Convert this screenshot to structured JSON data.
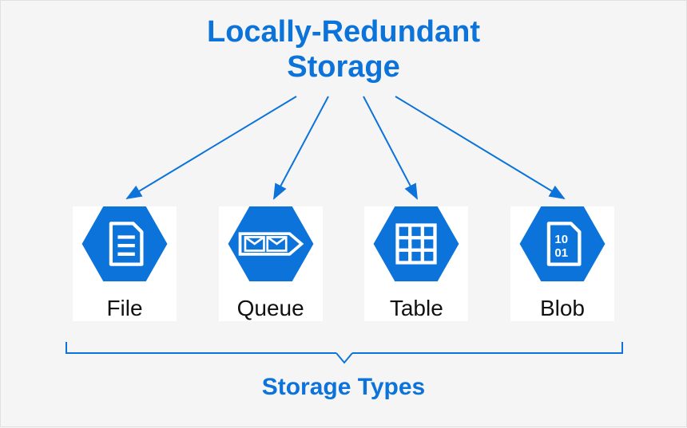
{
  "title_line1": "Locally-Redundant",
  "title_line2": "Storage",
  "items": [
    {
      "name": "file",
      "label": "File"
    },
    {
      "name": "queue",
      "label": "Queue"
    },
    {
      "name": "table",
      "label": "Table"
    },
    {
      "name": "blob",
      "label": "Blob"
    }
  ],
  "footer": "Storage Types",
  "colors": {
    "accent": "#0b73d9"
  }
}
